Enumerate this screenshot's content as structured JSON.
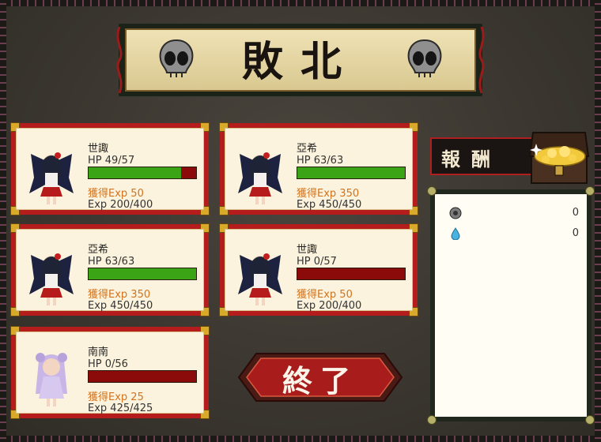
{
  "title": "敗北",
  "party": [
    {
      "name": "世諏",
      "hp": "HP 49/57",
      "hp_fraction": 0.86,
      "gained": "獲得Exp 50",
      "exp": "Exp 200/400",
      "sprite": "winged-girl-sprite"
    },
    {
      "name": "亞希",
      "hp": "HP 63/63",
      "hp_fraction": 1.0,
      "gained": "獲得Exp 350",
      "exp": "Exp 450/450",
      "sprite": "winged-girl-sprite"
    },
    {
      "name": "亞希",
      "hp": "HP 63/63",
      "hp_fraction": 1.0,
      "gained": "獲得Exp 350",
      "exp": "Exp 450/450",
      "sprite": "winged-girl-sprite"
    },
    {
      "name": "世諏",
      "hp": "HP 0/57",
      "hp_fraction": 0.0,
      "gained": "獲得Exp 50",
      "exp": "Exp 200/400",
      "sprite": "winged-girl-sprite"
    },
    {
      "name": "南南",
      "hp": "HP 0/56",
      "hp_fraction": 0.0,
      "gained": "獲得Exp 25",
      "exp": "Exp 425/425",
      "sprite": "lilac-girl-sprite"
    }
  ],
  "reward": {
    "label": "報酬",
    "items": [
      {
        "icon": "coin-icon",
        "value": "0"
      },
      {
        "icon": "water-drop-icon",
        "value": "0"
      }
    ]
  },
  "end_button": "終了",
  "colors": {
    "hp_fill": "#3aa416",
    "hp_empty": "#8b0a0a",
    "card_border": "#b51c1c",
    "gained_exp": "#d4731c"
  }
}
